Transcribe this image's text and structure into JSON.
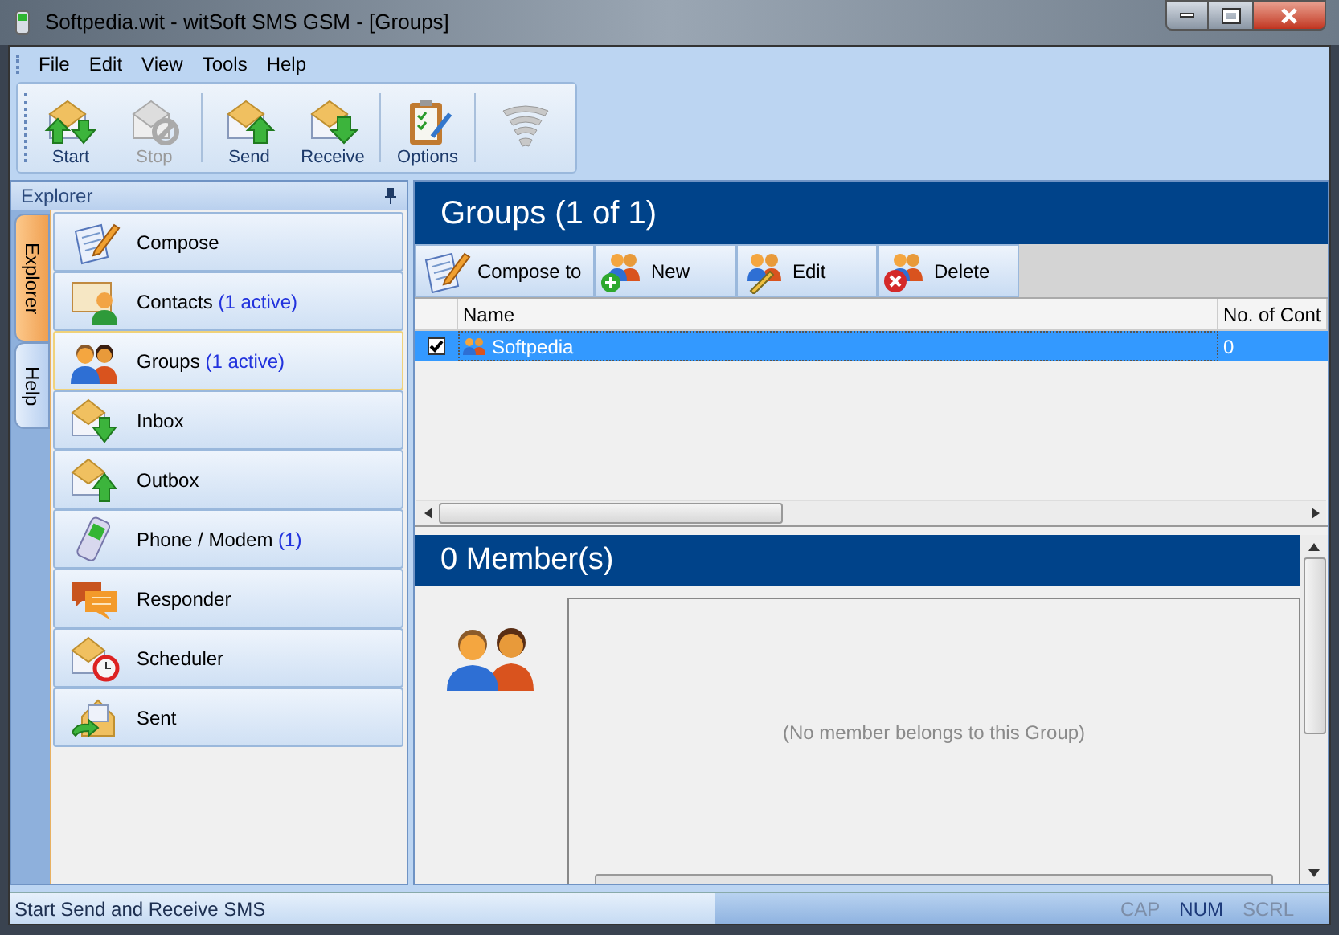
{
  "window": {
    "title": "Softpedia.wit - witSoft SMS GSM - [Groups]"
  },
  "menu": [
    "File",
    "Edit",
    "View",
    "Tools",
    "Help"
  ],
  "toolbar": [
    {
      "label": "Start",
      "disabled": false
    },
    {
      "label": "Stop",
      "disabled": true
    },
    {
      "label": "Send",
      "disabled": false
    },
    {
      "label": "Receive",
      "disabled": false
    },
    {
      "label": "Options",
      "disabled": false
    }
  ],
  "explorer": {
    "title": "Explorer",
    "tabs": [
      {
        "label": "Explorer",
        "selected": true
      },
      {
        "label": "Help",
        "selected": false
      }
    ],
    "items": [
      {
        "label": "Compose",
        "selected": false
      },
      {
        "label": "Contacts",
        "count": "(1 active)",
        "selected": false
      },
      {
        "label": "Groups",
        "count": "(1 active)",
        "selected": true
      },
      {
        "label": "Inbox",
        "selected": false
      },
      {
        "label": "Outbox",
        "selected": false
      },
      {
        "label": "Phone / Modem",
        "count": "(1)",
        "selected": false
      },
      {
        "label": "Responder",
        "selected": false
      },
      {
        "label": "Scheduler",
        "selected": false
      },
      {
        "label": "Sent",
        "selected": false
      }
    ]
  },
  "groups": {
    "title": "Groups (1 of 1)",
    "actions": [
      "Compose to",
      "New",
      "Edit",
      "Delete"
    ],
    "columns": [
      "Name",
      "No. of Cont"
    ],
    "rows": [
      {
        "checked": true,
        "selected": true,
        "name": "Softpedia",
        "count": "0"
      }
    ]
  },
  "members": {
    "title": "0 Member(s)",
    "empty_text": "(No member belongs to this Group)"
  },
  "status_bar": {
    "text": "Start Send and Receive SMS",
    "indicators": [
      {
        "label": "CAP",
        "on": false
      },
      {
        "label": "NUM",
        "on": true
      },
      {
        "label": "SCRL",
        "on": false
      }
    ]
  }
}
